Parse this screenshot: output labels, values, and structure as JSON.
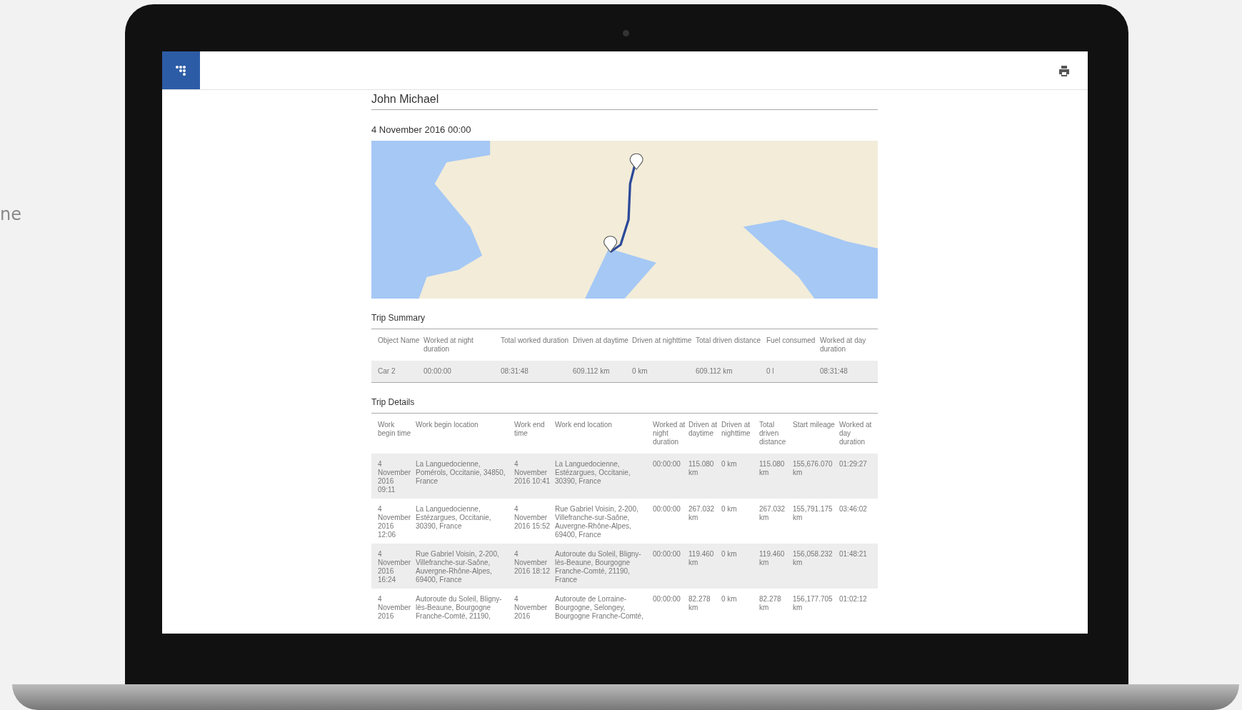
{
  "side_text": "ne",
  "report": {
    "name": "John Michael",
    "date": "4 November 2016 00:00",
    "summary": {
      "title": "Trip Summary",
      "columns": [
        "Object Name",
        "Worked at night duration",
        "Total worked duration",
        "Driven at daytime",
        "Driven at nighttime",
        "Total driven distance",
        "Fuel consumed",
        "Worked at day duration"
      ],
      "rows": [
        [
          "Car 2",
          "00:00:00",
          "08:31:48",
          "609.112 km",
          "0 km",
          "609.112 km",
          "0 l",
          "08:31:48"
        ]
      ]
    },
    "details": {
      "title": "Trip Details",
      "columns": [
        "Work begin time",
        "Work begin location",
        "Work end time",
        "Work end location",
        "Worked at night duration",
        "Driven at daytime",
        "Driven at nighttime",
        "Total driven distance",
        "Start mileage",
        "Worked at day duration"
      ],
      "rows": [
        [
          "4 November 2016 09:11",
          "La Languedocienne, Pomérols, Occitanie, 34850, France",
          "4 November 2016 10:41",
          "La Languedocienne, Estézargues, Occitanie, 30390, France",
          "00:00:00",
          "115.080 km",
          "0 km",
          "115.080 km",
          "155,676.070 km",
          "01:29:27"
        ],
        [
          "4 November 2016 12:06",
          "La Languedocienne, Estézargues, Occitanie, 30390, France",
          "4 November 2016 15:52",
          "Rue Gabriel Voisin, 2-200, Villefranche-sur-Saône, Auvergne-Rhône-Alpes, 69400, France",
          "00:00:00",
          "267.032 km",
          "0 km",
          "267.032 km",
          "155,791.175 km",
          "03:46:02"
        ],
        [
          "4 November 2016 16:24",
          "Rue Gabriel Voisin, 2-200, Villefranche-sur-Saône, Auvergne-Rhône-Alpes, 69400, France",
          "4 November 2016 18:12",
          "Autoroute du Soleil, Bligny-lès-Beaune, Bourgogne Franche-Comté, 21190, France",
          "00:00:00",
          "119.460 km",
          "0 km",
          "119.460 km",
          "156,058.232 km",
          "01:48:21"
        ],
        [
          "4 November 2016",
          "Autoroute du Soleil, Bligny-lès-Beaune, Bourgogne Franche-Comté, 21190,",
          "4 November 2016",
          "Autoroute de Lorraine-Bourgogne, Selongey, Bourgogne Franche-Comté,",
          "00:00:00",
          "82.278 km",
          "0 km",
          "82.278 km",
          "156,177.705 km",
          "01:02:12"
        ]
      ]
    }
  }
}
